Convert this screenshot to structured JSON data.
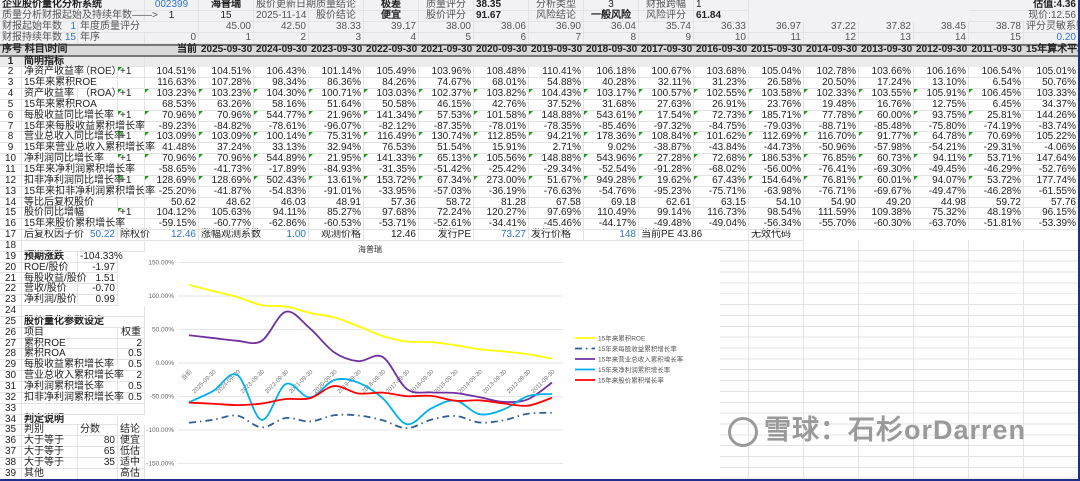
{
  "top": {
    "system_title": "企业股价量化分析系统",
    "stock_code": "002399",
    "stock_name": "海普瑞",
    "update_date_label": "股价更新日期",
    "quality_conclusion_label": "质量结论",
    "quality_conclusion": "极差",
    "quality_score_label": "质量评分",
    "quality_score": "38.35",
    "analysis_type_label": "分析类型",
    "analysis_type": "3",
    "report_span_label": "财报跨幅",
    "report_span": "1",
    "valuation": "估值:4.36",
    "period_label": "质量分析财报起始及持续年数——>",
    "period_start": "1",
    "period_years": "15",
    "update_date": "2025-11-14",
    "price_conclusion_label": "股价结论",
    "price_conclusion": "便宜",
    "price_score_label": "股价评分",
    "price_score": "91.67",
    "risk_conclusion_label": "风险结论",
    "risk_conclusion": "一般风险",
    "risk_score_label": "风险评分",
    "risk_score": "61.84",
    "current_price": "现价:12.56",
    "start_year_label": "财报起始年数",
    "start_year": "1",
    "annual_quality_label": "年度质量评分",
    "annual_quality": [
      "45.00",
      "42.50",
      "38.33",
      "39.17",
      "38.00",
      "38.06",
      "36.90",
      "36.04",
      "35.74",
      "36.33",
      "36.97",
      "37.22",
      "37.82",
      "38.45",
      "38.78"
    ],
    "sensitivity_label": "评分灵敏系数",
    "duration_label": "财报持续年数",
    "duration": "15",
    "year_order_label": "年序",
    "year_order": [
      "0",
      "1",
      "2",
      "3",
      "4",
      "5",
      "6",
      "7",
      "8",
      "9",
      "10",
      "11",
      "12",
      "13",
      "14",
      "15"
    ],
    "sensitivity": "0.20"
  },
  "header": {
    "seq": "序号",
    "subject": "科目\\时间",
    "columns": [
      "当前",
      "2025-09-30",
      "2024-09-30",
      "2023-09-30",
      "2022-09-30",
      "2021-09-30",
      "2020-09-30",
      "2019-09-30",
      "2018-09-30",
      "2017-09-30",
      "2016-09-30",
      "2015-09-30",
      "2014-09-30",
      "2013-09-30",
      "2012-09-30",
      "2011-09-30",
      "15年算术平均"
    ]
  },
  "rows": [
    {
      "num": "1",
      "label": "简明指标",
      "section": true
    },
    {
      "num": "2",
      "label": "净资产收益率",
      "label2": "（ROE）",
      "unit": "+1",
      "values": [
        "104.51%",
        "104.51%",
        "106.43%",
        "101.14%",
        "105.49%",
        "103.96%",
        "108.48%",
        "110.41%",
        "106.18%",
        "100.67%",
        "103.68%",
        "105.04%",
        "102.78%",
        "103.66%",
        "106.16%",
        "106.54%",
        "105.01%"
      ]
    },
    {
      "num": "3",
      "label": "15年来累积ROE",
      "values": [
        "116.63%",
        "107.28%",
        "98.34%",
        "86.36%",
        "84.26%",
        "74.67%",
        "68.01%",
        "54.88%",
        "40.28%",
        "32.11%",
        "31.23%",
        "26.58%",
        "20.50%",
        "17.24%",
        "13.10%",
        "6.54%",
        "50.76%"
      ]
    },
    {
      "num": "4",
      "label": "资产收益率",
      "label2": "（ROA）",
      "unit": "+1",
      "flagged": true,
      "values": [
        "103.23%",
        "103.23%",
        "104.30%",
        "100.71%",
        "103.03%",
        "102.37%",
        "103.82%",
        "104.43%",
        "103.17%",
        "100.57%",
        "102.55%",
        "103.58%",
        "102.33%",
        "103.55%",
        "105.91%",
        "106.45%",
        "103.33%"
      ]
    },
    {
      "num": "5",
      "label": "15年来累积ROA",
      "values": [
        "68.53%",
        "63.26%",
        "58.16%",
        "51.64%",
        "50.58%",
        "46.15%",
        "42.76%",
        "37.52%",
        "31.68%",
        "27.63%",
        "26.91%",
        "23.76%",
        "19.48%",
        "16.76%",
        "12.75%",
        "6.45%",
        "34.37%"
      ]
    },
    {
      "num": "6",
      "label": "每股收益同比增长率",
      "unit": "+1",
      "flagged": true,
      "values": [
        "70.96%",
        "70.96%",
        "544.77%",
        "21.96%",
        "141.34%",
        "57.53%",
        "101.58%",
        "148.88%",
        "543.61%",
        "17.54%",
        "72.73%",
        "185.71%",
        "77.78%",
        "60.00%",
        "93.75%",
        "25.81%",
        "144.26%"
      ]
    },
    {
      "num": "7",
      "label": "15年来每股收益累积增长率",
      "values": [
        "-89.23%",
        "-84.82%",
        "-78.61%",
        "-96.07%",
        "-82.12%",
        "-87.35%",
        "-78.01%",
        "-78.35%",
        "-85.46%",
        "-97.32%",
        "-84.75%",
        "-79.03%",
        "-88.71%",
        "-85.48%",
        "-75.80%",
        "-74.19%",
        "-83.74%"
      ]
    },
    {
      "num": "8",
      "label": "营业总收入同比增长率",
      "unit": "+1",
      "flagged": true,
      "values": [
        "103.09%",
        "103.09%",
        "100.14%",
        "75.31%",
        "116.49%",
        "130.74%",
        "112.85%",
        "94.21%",
        "178.36%",
        "108.84%",
        "101.62%",
        "112.69%",
        "116.70%",
        "91.77%",
        "64.78%",
        "70.69%",
        "105.22%"
      ]
    },
    {
      "num": "9",
      "label": "15年来营业总收入累积增长率",
      "values": [
        "41.48%",
        "37.24%",
        "33.13%",
        "32.94%",
        "76.53%",
        "51.54%",
        "15.91%",
        "2.71%",
        "9.02%",
        "-38.87%",
        "-43.84%",
        "-44.73%",
        "-50.96%",
        "-57.98%",
        "-54.21%",
        "-29.31%",
        "-4.06%"
      ]
    },
    {
      "num": "10",
      "label": "净利润同比增长率",
      "unit": "+1",
      "flagged": true,
      "values": [
        "70.96%",
        "70.96%",
        "544.89%",
        "21.95%",
        "141.33%",
        "65.13%",
        "105.56%",
        "148.88%",
        "543.96%",
        "27.28%",
        "72.68%",
        "186.53%",
        "76.85%",
        "60.73%",
        "94.11%",
        "53.71%",
        "147.64%"
      ]
    },
    {
      "num": "11",
      "label": "15年来净利润累积增长率",
      "values": [
        "-58.65%",
        "-41.73%",
        "-17.89%",
        "-84.93%",
        "-31.35%",
        "-51.42%",
        "-25.42%",
        "-29.34%",
        "-52.54%",
        "-91.28%",
        "-68.02%",
        "-56.00%",
        "-76.41%",
        "-69.30%",
        "-49.45%",
        "-46.29%",
        "-52.76%"
      ]
    },
    {
      "num": "12",
      "label": "扣非净利润同比增长率",
      "unit": "+1",
      "flagged": true,
      "values": [
        "128.69%",
        "128.69%",
        "502.43%",
        "13.61%",
        "153.72%",
        "67.34%",
        "273.00%",
        "51.67%",
        "949.28%",
        "19.62%",
        "67.43%",
        "154.64%",
        "76.81%",
        "60.01%",
        "94.07%",
        "53.72%",
        "177.74%"
      ]
    },
    {
      "num": "13",
      "label": "15年来扣非净利润累积增长率",
      "values": [
        "-25.20%",
        "-41.87%",
        "-54.83%",
        "-91.01%",
        "-33.95%",
        "-57.03%",
        "-36.19%",
        "-76.63%",
        "-54.76%",
        "-95.23%",
        "-75.71%",
        "-63.98%",
        "-76.71%",
        "-69.67%",
        "-49.47%",
        "-46.28%",
        "-61.55%"
      ]
    },
    {
      "num": "14",
      "label": "等比后复权股价",
      "values": [
        "50.62",
        "48.62",
        "46.03",
        "48.91",
        "57.36",
        "58.72",
        "81.28",
        "67.58",
        "69.18",
        "62.61",
        "63.15",
        "54.10",
        "54.90",
        "49.20",
        "44.98",
        "59.72",
        "57.76"
      ]
    },
    {
      "num": "15",
      "label": "股价同比增幅",
      "unit": "+1",
      "values": [
        "104.12%",
        "105.63%",
        "94.11%",
        "85.27%",
        "97.68%",
        "72.24%",
        "120.27%",
        "97.69%",
        "110.49%",
        "99.14%",
        "116.73%",
        "98.54%",
        "111.59%",
        "109.38%",
        "75.32%",
        "48.19%",
        "96.15%"
      ]
    },
    {
      "num": "16",
      "label": "15年来股价累积增长率",
      "values": [
        "-59.15%",
        "-60.77%",
        "-62.86%",
        "-60.53%",
        "-53.71%",
        "-52.61%",
        "-34.41%",
        "-45.46%",
        "-44.17%",
        "-49.48%",
        "-49.04%",
        "-56.34%",
        "-55.70%",
        "-60.30%",
        "-63.70%",
        "-51.81%",
        "-53.39%"
      ]
    }
  ],
  "row17": {
    "num": "17",
    "label": "后复权因子价",
    "factor_price": "50.22",
    "ex_price_label": "除权价",
    "ex_price": "12.46",
    "coef_label": "涨幅观测系数",
    "coef": "1.00",
    "obs_price_label": "观测价格",
    "obs_price": "12.46",
    "ipo_pe_label": "发行PE",
    "ipo_pe": "73.27",
    "ipo_price_label": "发行价格",
    "ipo_price": "148",
    "current_pe": "当前PE 43.86",
    "invalid_code": "无效代码"
  },
  "lower": {
    "nums": [
      "18",
      "19",
      "20",
      "21",
      "22",
      "23",
      "24",
      "25",
      "26",
      "27",
      "28",
      "29",
      "30",
      "31",
      "32",
      "33",
      "34",
      "35",
      "36",
      "37",
      "38",
      "39"
    ],
    "expected_label": "预期涨跌",
    "expected": "-104.33%",
    "ratios": [
      {
        "label": "ROE/股价",
        "value": "-1.97"
      },
      {
        "label": "每股收益/股价",
        "value": "1.51"
      },
      {
        "label": "营收/股价",
        "value": "-0.70"
      },
      {
        "label": "净利润/股价",
        "value": "0.99"
      }
    ],
    "params_title": "股价量化参数设定",
    "item_label": "项目",
    "weight_label": "权重",
    "params": [
      {
        "label": "累积ROE",
        "weight": "2"
      },
      {
        "label": "累积ROA",
        "weight": "0.5"
      },
      {
        "label": "每股收益累积增长率",
        "weight": "0.5"
      },
      {
        "label": "营业总收入累积增长率",
        "weight": "2"
      },
      {
        "label": "净利润累积增长率",
        "weight": "0.5"
      },
      {
        "label": "扣非净利润累积增长率",
        "weight": "0.5"
      }
    ],
    "judge_title": "判定说明",
    "judge_label": "判别",
    "score_label": "分数",
    "result_label": "结论",
    "judges": [
      {
        "rule": "大于等于",
        "score": "80",
        "result": "便宜"
      },
      {
        "rule": "大于等于",
        "score": "65",
        "result": "低估"
      },
      {
        "rule": "大于等于",
        "score": "35",
        "result": "适中"
      },
      {
        "rule": "其他",
        "score": "",
        "result": "高估"
      }
    ]
  },
  "chart_data": {
    "type": "line",
    "title": "海普瑞",
    "categories": [
      "当前",
      "2025-09-30",
      "2024-09-30",
      "2023-09-30",
      "2022-09-30",
      "2021-09-30",
      "2020-09-30",
      "2019-09-30",
      "2018-09-30",
      "2017-09-30",
      "2016-09-30",
      "2015-09-30",
      "2014-09-30",
      "2013-09-30",
      "2012-09-30",
      "2011-09-30"
    ],
    "yticks": [
      "150.00%",
      "100.00%",
      "50.00%",
      "0.00%",
      "-50.00%",
      "-100.00%",
      "-150.00%"
    ],
    "ylim": [
      -150,
      150
    ],
    "grid": true,
    "legend": "right",
    "series": [
      {
        "name": "15年来累积ROE",
        "color": "#ffff00",
        "dash": false,
        "values": [
          116.63,
          107.28,
          98.34,
          86.36,
          84.26,
          74.67,
          68.01,
          54.88,
          40.28,
          32.11,
          31.23,
          26.58,
          20.5,
          17.24,
          13.1,
          6.54
        ]
      },
      {
        "name": "15年来每股收益累积增长率",
        "color": "#2e5f9a",
        "dash": true,
        "values": [
          -89.23,
          -84.82,
          -78.61,
          -96.07,
          -82.12,
          -87.35,
          -78.01,
          -78.35,
          -85.46,
          -97.32,
          -84.75,
          -79.03,
          -88.71,
          -85.48,
          -75.8,
          -74.19
        ]
      },
      {
        "name": "15年来营业总收入累积增长率",
        "color": "#7030a0",
        "dash": false,
        "values": [
          41.48,
          37.24,
          33.13,
          32.94,
          76.53,
          51.54,
          15.91,
          2.71,
          9.02,
          -38.87,
          -43.84,
          -44.73,
          -50.96,
          -57.98,
          -54.21,
          -29.31
        ]
      },
      {
        "name": "15年来净利润累积增长率",
        "color": "#00b0f0",
        "dash": false,
        "values": [
          -58.65,
          -41.73,
          -17.89,
          -84.93,
          -31.35,
          -51.42,
          -25.42,
          -29.34,
          -52.54,
          -91.28,
          -68.02,
          -56.0,
          -76.41,
          -69.3,
          -49.45,
          -46.29
        ]
      },
      {
        "name": "15年来股价累积增长率",
        "color": "#ff0000",
        "dash": false,
        "values": [
          -59.15,
          -60.77,
          -62.86,
          -60.53,
          -53.71,
          -52.61,
          -34.41,
          -45.46,
          -44.17,
          -49.48,
          -49.04,
          -56.34,
          -55.7,
          -60.3,
          -63.7,
          -51.81
        ]
      }
    ]
  },
  "watermark": "雪球：石杉orDarren"
}
